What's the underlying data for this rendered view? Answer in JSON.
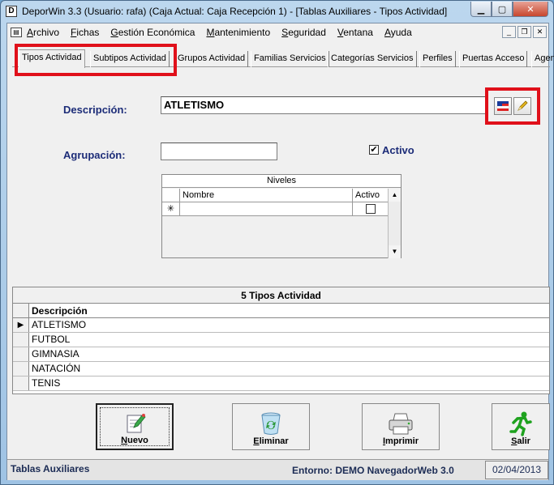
{
  "window": {
    "app_icon": "D",
    "title": "DeporWin 3.3  (Usuario: rafa)  (Caja Actual: Caja Recepción 1) - [Tablas Auxiliares - Tipos Actividad]",
    "min_symbol": "▁",
    "max_symbol": "▢",
    "close_symbol": "✕"
  },
  "menubar": {
    "items": [
      "Archivo",
      "Fichas",
      "Gestión Económica",
      "Mantenimiento",
      "Seguridad",
      "Ventana",
      "Ayuda"
    ],
    "mdi_min": "_",
    "mdi_restore": "❐",
    "mdi_close": "✕"
  },
  "tabs": [
    "Tipos Actividad",
    "Subtipos Actividad",
    "Grupos Actividad",
    "Familias Servicios",
    "Categorías Servicios",
    "Perfiles",
    "Puertas Acceso",
    "Agen"
  ],
  "form": {
    "descripcion_label": "Descripción:",
    "descripcion_value": "ATLETISMO",
    "agrupacion_label": "Agrupación:",
    "agrupacion_value": "",
    "activo_label": "Activo",
    "activo_checked": true,
    "check_mark": "✔"
  },
  "niveles": {
    "title": "Niveles",
    "columns": [
      "Nombre",
      "Activo"
    ],
    "new_row_marker": "✳",
    "scroll_up": "▲",
    "scroll_down": "▼"
  },
  "tipos": {
    "title": "5 Tipos Actividad",
    "column": "Descripción",
    "current_marker": "▶",
    "rows": [
      "ATLETISMO",
      "FUTBOL",
      "GIMNASIA",
      "NATACIÓN",
      "TENIS"
    ]
  },
  "actions": {
    "nuevo": "Nuevo",
    "eliminar": "Eliminar",
    "imprimir": "Imprimir",
    "salir": "Salir"
  },
  "status": {
    "left": "Tablas Auxiliares",
    "middle": "Entorno: DEMO NavegadorWeb 3.0",
    "date": "02/04/2013"
  },
  "colors": {
    "highlight": "#e0101a",
    "label_blue": "#1c2c78"
  }
}
